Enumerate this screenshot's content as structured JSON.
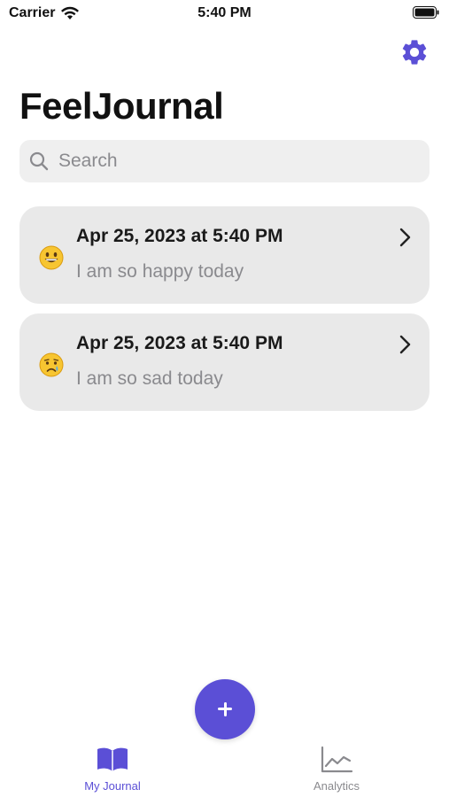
{
  "status_bar": {
    "carrier": "Carrier",
    "time": "5:40 PM"
  },
  "header": {
    "title": "FeelJournal",
    "settings_icon": "gear-icon"
  },
  "search": {
    "placeholder": "Search",
    "value": ""
  },
  "entries": [
    {
      "emoji": "grinning-face",
      "date": "Apr 25, 2023 at 5:40 PM",
      "note": "I am so happy today"
    },
    {
      "emoji": "crying-face",
      "date": "Apr 25, 2023 at 5:40 PM",
      "note": "I am so sad today"
    }
  ],
  "fab": {
    "icon": "plus-icon"
  },
  "tabs": [
    {
      "label": "My Journal",
      "icon": "book-icon",
      "active": true
    },
    {
      "label": "Analytics",
      "icon": "chart-icon",
      "active": false
    }
  ],
  "colors": {
    "accent": "#5b4fd6",
    "card": "#e9e9e9",
    "muted": "#8a8a8e"
  }
}
